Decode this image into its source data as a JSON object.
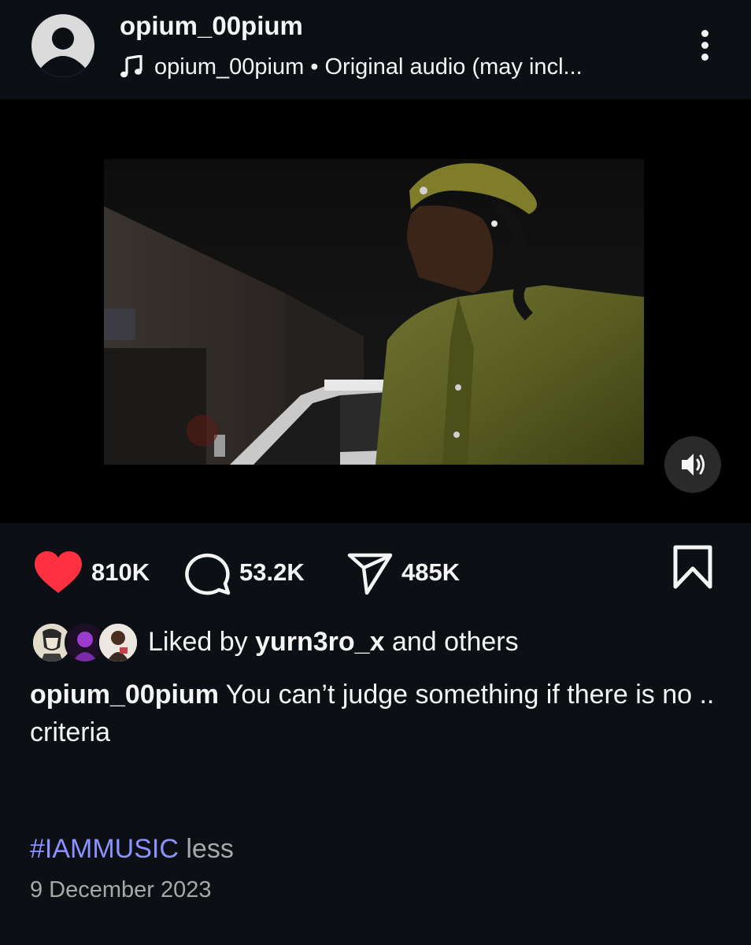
{
  "post": {
    "username": "opium_00pium",
    "audio_label": "opium_00pium • Original audio (may incl...",
    "date": "9 December 2023"
  },
  "actions": {
    "likes": "810K",
    "comments": "53.2K",
    "shares": "485K"
  },
  "liked_by": {
    "prefix": "Liked by ",
    "user": "yurn3ro_x",
    "suffix": " and others"
  },
  "caption": {
    "username": "opium_00pium",
    "line1": " You can’t judge something if there is no ..",
    "line2": "criteria",
    "hashtag": "#IAMMUSIC",
    "less": " less"
  },
  "colors": {
    "background": "#0c1014",
    "like": "#ff3040",
    "hashtag": "#8c91ff"
  },
  "icons": [
    "more-icon",
    "music-note-icon",
    "volume-icon",
    "heart-icon",
    "comment-icon",
    "share-icon",
    "bookmark-icon"
  ]
}
